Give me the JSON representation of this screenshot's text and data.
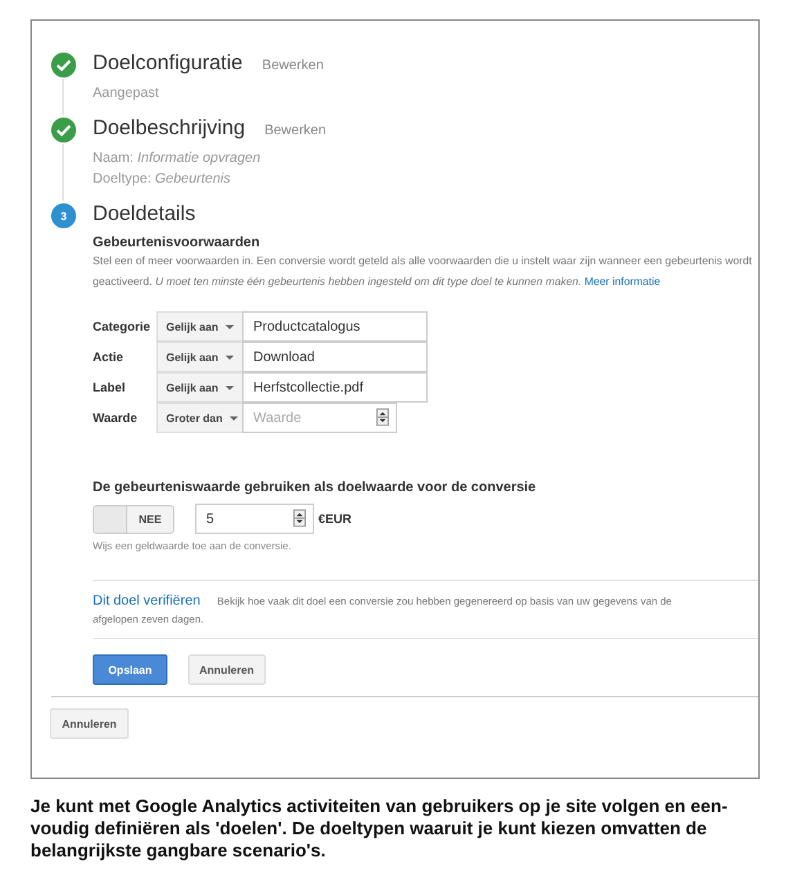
{
  "steps": [
    {
      "kind": "done",
      "title": "Doelconfiguratie",
      "edit": "Bewerken",
      "details": [
        "Aangepast"
      ]
    },
    {
      "kind": "done",
      "title": "Doelbeschrijving",
      "edit": "Bewerken",
      "details": [
        "Naam: *Informatie opvragen*",
        "Doeltype: *Gebeurtenis*"
      ]
    },
    {
      "kind": "current",
      "number": "3",
      "title": "Doeldetails"
    }
  ],
  "conditions": {
    "heading": "Gebeurtenisvoorwaarden",
    "description": "Stel een of meer voorwaarden in. Een conversie wordt geteld als alle voorwaarden die u instelt waar zijn wanneer een gebeurtenis wordt geactiveerd. *U moet ten minste één gebeurtenis hebben ingesteld om dit type doel te kunnen maken.*",
    "link": "Meer informatie",
    "rows": [
      {
        "label": "Categorie",
        "operator": "Gelijk aan",
        "kind": "text",
        "value": "Productcatalogus"
      },
      {
        "label": "Actie",
        "operator": "Gelijk aan",
        "kind": "text",
        "value": "Download"
      },
      {
        "label": "Label",
        "operator": "Gelijk aan",
        "kind": "text",
        "value": "Herfstcollectie.pdf"
      },
      {
        "label": "Waarde",
        "operator": "Groter dan",
        "kind": "number",
        "placeholder": "Waarde"
      }
    ]
  },
  "goal_value": {
    "heading": "De gebeurteniswaarde gebruiken als doelwaarde voor de conversie",
    "toggle": {
      "label": "NEE",
      "on": false
    },
    "amount": "5",
    "currency": "€EUR",
    "hint": "Wijs een geldwaarde toe aan de conversie."
  },
  "verify": {
    "link": "Dit doel verifiëren",
    "text": "Bekijk hoe vaak dit doel een conversie zou hebben gegenereerd op basis van uw gegevens van de afgelopen zeven dagen."
  },
  "buttons": [
    {
      "label": "Opslaan",
      "primary": true
    },
    {
      "label": "Annuleren",
      "primary": false
    }
  ],
  "outer_button": "Annuleren",
  "caption": "Je kunt met Google Analytics activiteiten van gebruikers op je site volgen en een-voudig definiëren als 'doelen'. De doeltypen waaruit je kunt kiezen omvatten de belangrijkste gangbare scenario's."
}
